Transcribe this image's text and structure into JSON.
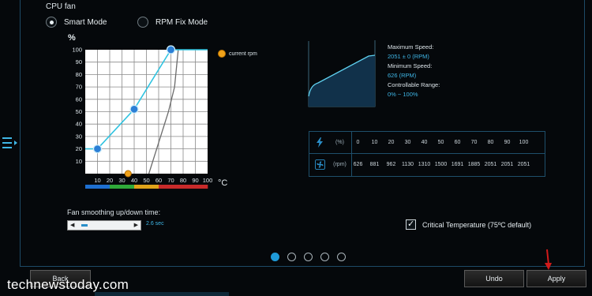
{
  "title": "CPU fan",
  "modes": [
    {
      "label": "Smart Mode",
      "selected": true
    },
    {
      "label": "RPM Fix Mode",
      "selected": false
    }
  ],
  "chart": {
    "y_unit": "%",
    "x_unit": "°C",
    "legend": "current rpm"
  },
  "chart_data": {
    "type": "line",
    "xlabel": "°C",
    "ylabel": "%",
    "xlim": [
      0,
      100
    ],
    "ylim": [
      0,
      100
    ],
    "x_ticks": [
      "10",
      "20",
      "30",
      "40",
      "50",
      "60",
      "70",
      "80",
      "90",
      "100"
    ],
    "y_ticks": [
      "10",
      "20",
      "30",
      "40",
      "50",
      "60",
      "70",
      "80",
      "90",
      "100"
    ],
    "series": [
      {
        "values": [
          [
            0,
            20
          ],
          [
            10,
            20
          ],
          [
            40,
            52
          ],
          [
            70,
            100
          ],
          [
            100,
            100
          ]
        ]
      },
      {
        "values": [
          [
            52,
            0
          ],
          [
            68,
            50
          ],
          [
            73,
            70
          ],
          [
            76,
            100
          ]
        ]
      }
    ],
    "control_points": [
      [
        10,
        20
      ],
      [
        40,
        52
      ],
      [
        70,
        100
      ]
    ],
    "current_rpm": [
      35,
      0
    ],
    "temperature_bands": [
      "#1e6fd0",
      "#1e6fd0",
      "#2faa3a",
      "#2faa3a",
      "#e0a319",
      "#e0a319",
      "#c82a2a",
      "#c82a2a",
      "#c82a2a",
      "#c82a2a"
    ],
    "grid": true
  },
  "info": {
    "max_label": "Maximum Speed:",
    "max_value": "2051 ± 0 (RPM)",
    "min_label": "Minimum Speed:",
    "min_value": "626 (RPM)",
    "range_label": "Controllable Range:",
    "range_value": "0% ~ 100%"
  },
  "speed_table": {
    "percent_unit": "(%)",
    "rpm_unit": "(rpm)",
    "percent": [
      "0",
      "10",
      "20",
      "30",
      "40",
      "50",
      "60",
      "70",
      "80",
      "90",
      "100"
    ],
    "rpm": [
      "626",
      "881",
      "962",
      "1130",
      "1310",
      "1500",
      "1691",
      "1885",
      "2051",
      "2051",
      "2051"
    ]
  },
  "smoothing": {
    "label": "Fan smoothing up/down time:",
    "value": "2.6 sec",
    "fraction": 0.1
  },
  "critical": {
    "label": "Critical Temperature (75ºC default)",
    "checked": true
  },
  "pager": {
    "count": 5,
    "active": 0
  },
  "buttons": {
    "back": "Back",
    "undo": "Undo",
    "apply": "Apply"
  },
  "watermark": "technewstoday.com",
  "colors": {
    "accent": "#1f9ad8",
    "curve": "#2fc3e0",
    "current": "#f0a21a"
  }
}
